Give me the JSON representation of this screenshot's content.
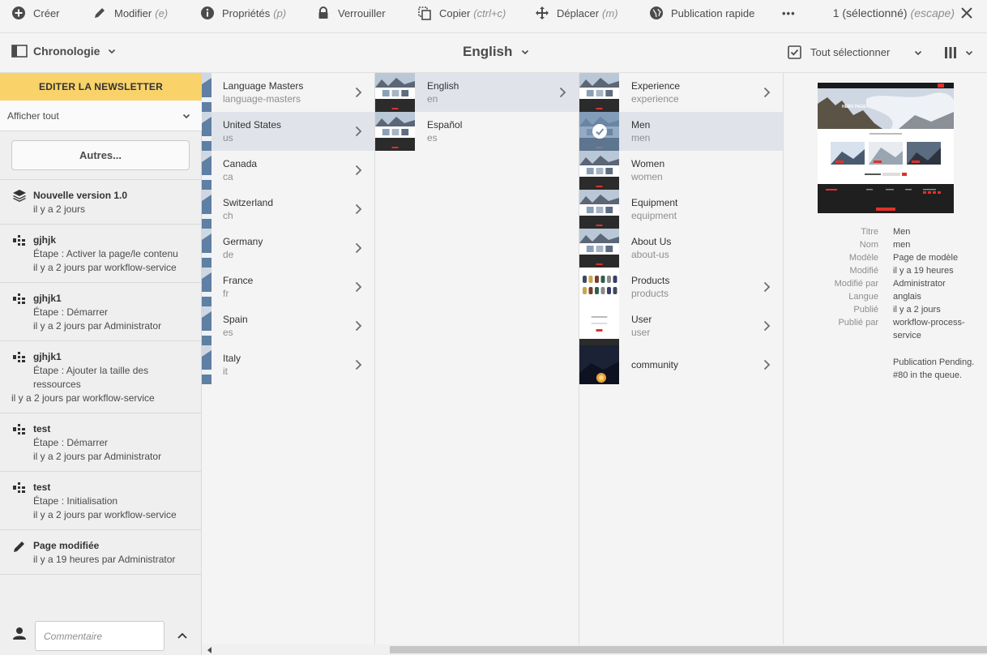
{
  "actionbar": {
    "items": [
      {
        "label": "Créer",
        "shortcut": "",
        "icon": "add-circle-icon"
      },
      {
        "label": "Modifier",
        "shortcut": "(e)",
        "icon": "edit-icon"
      },
      {
        "label": "Propriétés",
        "shortcut": "(p)",
        "icon": "info-icon"
      },
      {
        "label": "Verrouiller",
        "shortcut": "",
        "icon": "lock-icon"
      },
      {
        "label": "Copier",
        "shortcut": "(ctrl+c)",
        "icon": "copy-icon"
      },
      {
        "label": "Déplacer",
        "shortcut": "(m)",
        "icon": "move-icon"
      },
      {
        "label": "Publication rapide",
        "shortcut": "",
        "icon": "globe-icon"
      },
      {
        "label": "•••",
        "shortcut": "",
        "icon": "more-icon"
      }
    ],
    "selection": "1 (sélectionné)",
    "selection_shortcut": "(escape)"
  },
  "header": {
    "rail_label": "Chronologie",
    "path_title": "English",
    "select_all": "Tout sélectionner"
  },
  "rail": {
    "action_button": "EDITER LA NEWSLETTER",
    "filter": "Afficher tout",
    "more_button": "Autres...",
    "comment_placeholder": "Commentaire",
    "items": [
      {
        "title": "Nouvelle version 1.0",
        "lines": [
          "il y a 2 jours"
        ],
        "icon": "layers-icon"
      },
      {
        "title": "gjhjk",
        "lines": [
          "Étape : Activer la page/le contenu",
          "il y a 2 jours par workflow-service"
        ],
        "icon": "workflow-icon"
      },
      {
        "title": "gjhjk1",
        "lines": [
          "Étape : Démarrer",
          "il y a 2 jours par Administrator"
        ],
        "icon": "workflow-icon"
      },
      {
        "title": "gjhjk1",
        "lines": [
          "Étape : Ajouter la taille des",
          "ressources",
          "il y a 2 jours par workflow-service"
        ],
        "icon": "workflow-icon"
      },
      {
        "title": "test",
        "lines": [
          "Étape : Démarrer",
          "il y a 2 jours par Administrator"
        ],
        "icon": "workflow-icon"
      },
      {
        "title": "test",
        "lines": [
          "Étape : Initialisation",
          "il y a 2 jours par workflow-service"
        ],
        "icon": "workflow-icon"
      },
      {
        "title": "Page modifiée",
        "lines": [
          "il y a 19 heures par Administrator"
        ],
        "icon": "pencil-icon"
      }
    ]
  },
  "columns": [
    {
      "items": [
        {
          "title": "Language Masters",
          "name": "language-masters",
          "selected": false,
          "has_children": true
        },
        {
          "title": "United States",
          "name": "us",
          "selected": true,
          "has_children": true
        },
        {
          "title": "Canada",
          "name": "ca",
          "selected": false,
          "has_children": true
        },
        {
          "title": "Switzerland",
          "name": "ch",
          "selected": false,
          "has_children": true
        },
        {
          "title": "Germany",
          "name": "de",
          "selected": false,
          "has_children": true
        },
        {
          "title": "France",
          "name": "fr",
          "selected": false,
          "has_children": true
        },
        {
          "title": "Spain",
          "name": "es",
          "selected": false,
          "has_children": true
        },
        {
          "title": "Italy",
          "name": "it",
          "selected": false,
          "has_children": true
        }
      ]
    },
    {
      "items": [
        {
          "title": "English",
          "name": "en",
          "selected": true,
          "has_children": true
        },
        {
          "title": "Español",
          "name": "es",
          "selected": false,
          "has_children": false
        }
      ]
    },
    {
      "items": [
        {
          "title": "Experience",
          "name": "experience",
          "selected": false,
          "has_children": true
        },
        {
          "title": "Men",
          "name": "men",
          "selected": true,
          "checked": true,
          "has_children": false
        },
        {
          "title": "Women",
          "name": "women",
          "selected": false,
          "has_children": false
        },
        {
          "title": "Equipment",
          "name": "equipment",
          "selected": false,
          "has_children": false
        },
        {
          "title": "About Us",
          "name": "about-us",
          "selected": false,
          "has_children": false
        },
        {
          "title": "Products",
          "name": "products",
          "selected": false,
          "has_children": true
        },
        {
          "title": "User",
          "name": "user",
          "selected": false,
          "has_children": true
        },
        {
          "title": "community",
          "name": "",
          "selected": false,
          "has_children": true
        }
      ]
    }
  ],
  "preview": {
    "thumbnail_text": "HERO PAGE",
    "meta": [
      {
        "key": "Titre",
        "value": "Men"
      },
      {
        "key": "Nom",
        "value": "men"
      },
      {
        "key": "Modèle",
        "value": "Page de modèle"
      },
      {
        "key": "Modifié",
        "value": "il y a 19 heures"
      },
      {
        "key": "Modifié par",
        "value": "Administrator"
      },
      {
        "key": "Langue",
        "value": "anglais"
      },
      {
        "key": "Publié",
        "value": "il y a 2 jours"
      },
      {
        "key": "Publié par",
        "value": "workflow-process-service"
      }
    ],
    "status": "Publication Pending. #80 in the queue."
  },
  "colors": {
    "accent_yellow": "#f9d26a",
    "selected_row": "#e0e4ea",
    "check_blue": "#6f8fb0"
  }
}
